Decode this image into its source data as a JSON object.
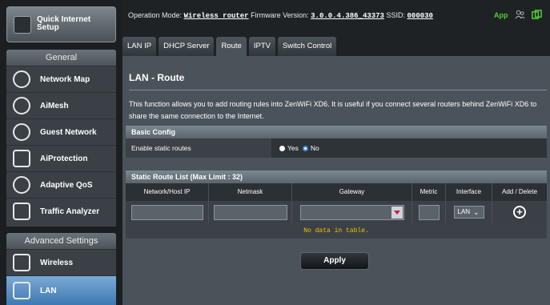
{
  "sidebar": {
    "qis_label": "Quick Internet Setup",
    "general_label": "General",
    "advanced_label": "Advanced Settings",
    "general_items": [
      {
        "label": "Network Map"
      },
      {
        "label": "AiMesh"
      },
      {
        "label": "Guest Network"
      },
      {
        "label": "AiProtection"
      },
      {
        "label": "Adaptive QoS"
      },
      {
        "label": "Traffic Analyzer"
      }
    ],
    "advanced_items": [
      {
        "label": "Wireless"
      },
      {
        "label": "LAN"
      }
    ]
  },
  "topbar": {
    "mode_label": "Operation Mode:",
    "mode_value": "Wireless router",
    "fw_label": "Firmware Version:",
    "fw_value": "3.0.0.4.386_43373",
    "ssid_label": "SSID:",
    "ssid_value": "000030",
    "app_label": "App"
  },
  "tabs": [
    "LAN IP",
    "DHCP Server",
    "Route",
    "IPTV",
    "Switch Control"
  ],
  "page": {
    "title": "LAN - Route",
    "description": "This function allows you to add routing rules into ZenWiFi XD6. It is useful if you connect several routers behind ZenWiFi XD6 to share the same connection to the Internet.",
    "basic_header": "Basic Config",
    "enable_label": "Enable static routes",
    "yes_label": "Yes",
    "no_label": "No",
    "list_header": "Static Route List (Max Limit : 32)",
    "columns": [
      "Network/Host IP",
      "Netmask",
      "Gateway",
      "Metric",
      "Interface",
      "Add / Delete"
    ],
    "interface_value": "LAN",
    "no_data": "No data in table.",
    "apply_label": "Apply"
  },
  "colors": {
    "accent": "#3d8cdb",
    "active_nav": "#5b94c9",
    "no_data_text": "#f5c300",
    "app_green": "#4fcf36"
  }
}
